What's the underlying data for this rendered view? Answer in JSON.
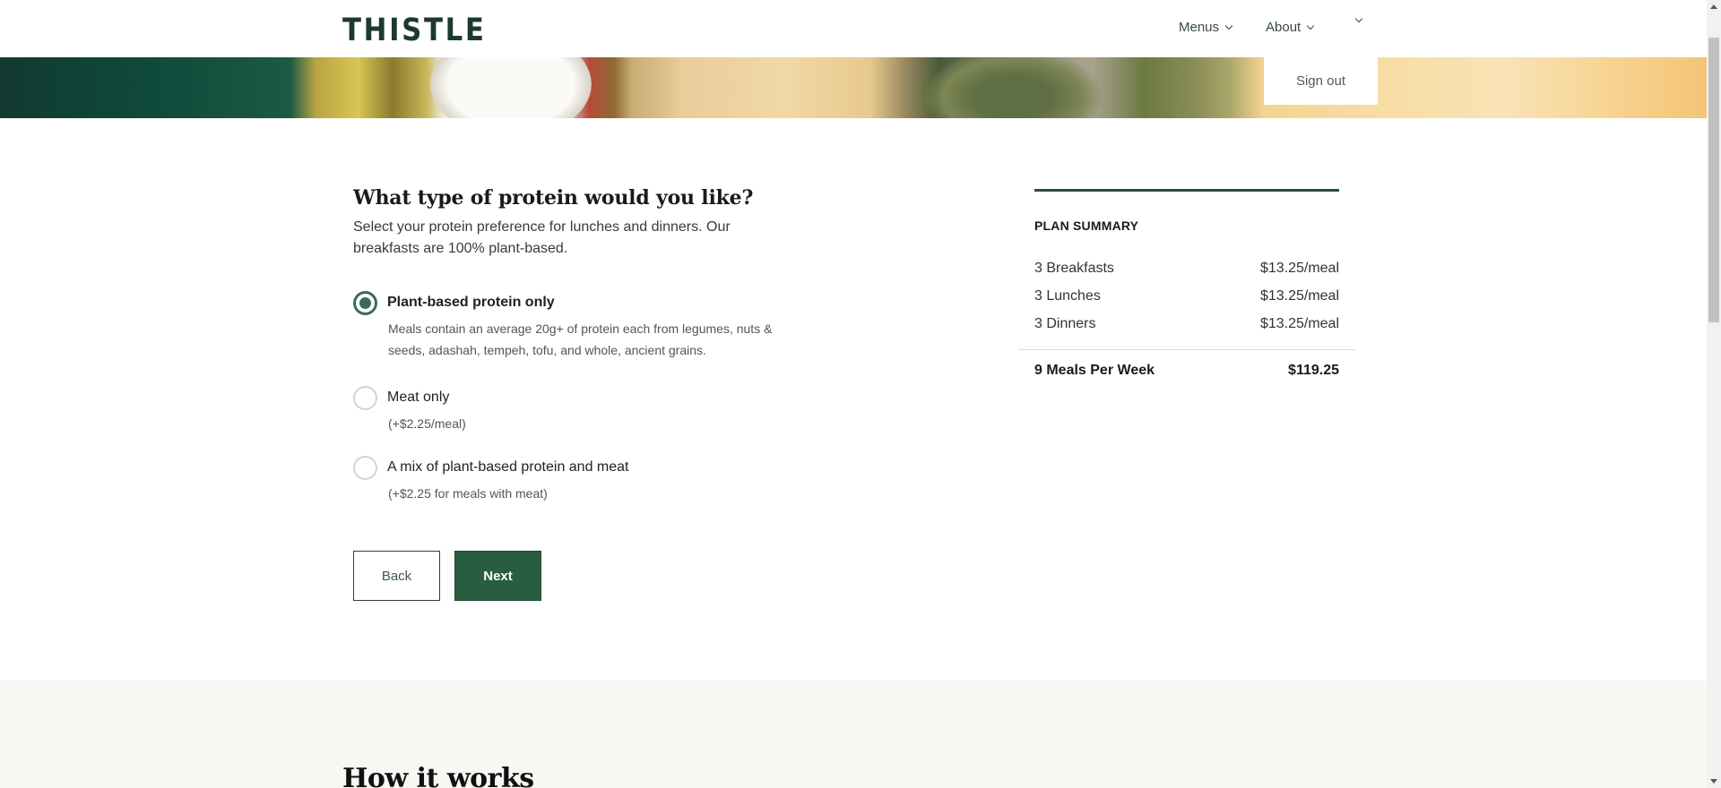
{
  "header": {
    "logo": "THISTLE",
    "nav": [
      {
        "label": "Menus"
      },
      {
        "label": "About"
      },
      {
        "label": ""
      }
    ],
    "account_menu": {
      "items": [
        "Sign out"
      ]
    }
  },
  "question": {
    "title": "What type of protein would you like?",
    "subtitle": "Select your protein preference for lunches and dinners. Our breakfasts are 100% plant-based.",
    "options": [
      {
        "label": "Plant-based protein only",
        "description": "Meals contain an average 20g+ of protein each from legumes, nuts & seeds, adashah, tempeh, tofu, and whole, ancient grains.",
        "selected": true
      },
      {
        "label": "Meat only",
        "description": "(+$2.25/meal)",
        "selected": false
      },
      {
        "label": "A mix of plant-based protein and meat",
        "description": "(+$2.25 for meals with meat)",
        "selected": false
      }
    ]
  },
  "actions": {
    "back_label": "Back",
    "next_label": "Next"
  },
  "plan_summary": {
    "title": "PLAN SUMMARY",
    "rows": [
      {
        "label": "3 Breakfasts",
        "price": "$13.25/meal"
      },
      {
        "label": "3 Lunches",
        "price": "$13.25/meal"
      },
      {
        "label": "3 Dinners",
        "price": "$13.25/meal"
      }
    ],
    "total": {
      "label": "9 Meals Per Week",
      "price": "$119.25"
    }
  },
  "how_it_works": {
    "title": "How it works"
  },
  "colors": {
    "brand_green": "#285e3f",
    "radio_selected": "#3d6a57",
    "logo": "#1d3a2c"
  }
}
